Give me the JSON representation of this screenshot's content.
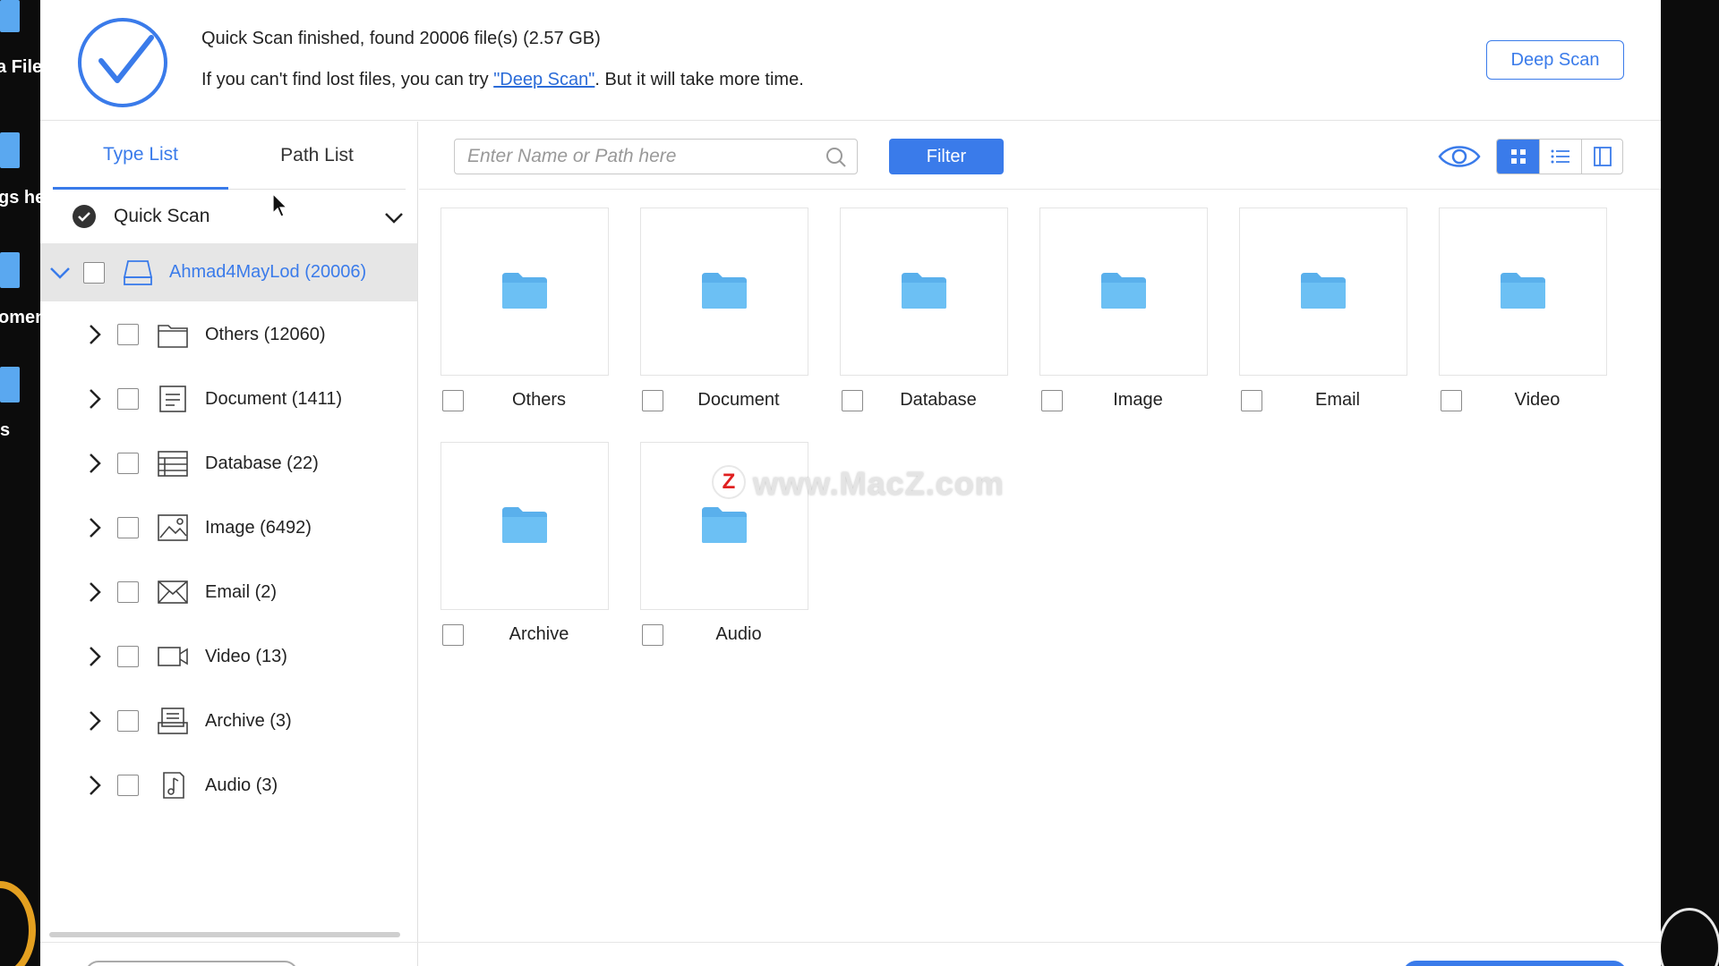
{
  "desktop": {
    "left_labels": [
      "a File",
      "gs he",
      "omen",
      "s"
    ]
  },
  "header": {
    "status_title": "Quick Scan finished, found 20006 file(s) (2.57 GB)",
    "hint_prefix": "If you can't find lost files, you can try ",
    "hint_link": "\"Deep Scan\"",
    "hint_suffix": ". But it will take more time.",
    "deep_scan_label": "Deep Scan"
  },
  "sidebar": {
    "tabs": [
      {
        "label": "Type List",
        "active": true
      },
      {
        "label": "Path List",
        "active": false
      }
    ],
    "scan_mode": "Quick Scan",
    "drive": {
      "label": "Ahmad4MayLod (20006)"
    },
    "items": [
      {
        "label": "Others (12060)",
        "icon": "folder-outline-icon"
      },
      {
        "label": "Document (1411)",
        "icon": "document-icon"
      },
      {
        "label": "Database (22)",
        "icon": "database-icon"
      },
      {
        "label": "Image (6492)",
        "icon": "image-icon"
      },
      {
        "label": "Email (2)",
        "icon": "email-icon"
      },
      {
        "label": "Video (13)",
        "icon": "video-icon"
      },
      {
        "label": "Archive (3)",
        "icon": "archive-icon"
      },
      {
        "label": "Audio (3)",
        "icon": "audio-icon"
      }
    ]
  },
  "toolbar": {
    "search_placeholder": "Enter Name or Path here",
    "filter_label": "Filter",
    "active_view": "grid"
  },
  "grid": {
    "tiles": [
      {
        "label": "Others"
      },
      {
        "label": "Document"
      },
      {
        "label": "Database"
      },
      {
        "label": "Image"
      },
      {
        "label": "Email"
      },
      {
        "label": "Video"
      },
      {
        "label": "Archive"
      },
      {
        "label": "Audio"
      }
    ]
  },
  "watermark": {
    "logo": "Z",
    "text": "www.MacZ.com"
  },
  "colors": {
    "accent": "#3a7bea",
    "folder": "#5ab0ec",
    "selected_row": "#e6e6e6"
  }
}
